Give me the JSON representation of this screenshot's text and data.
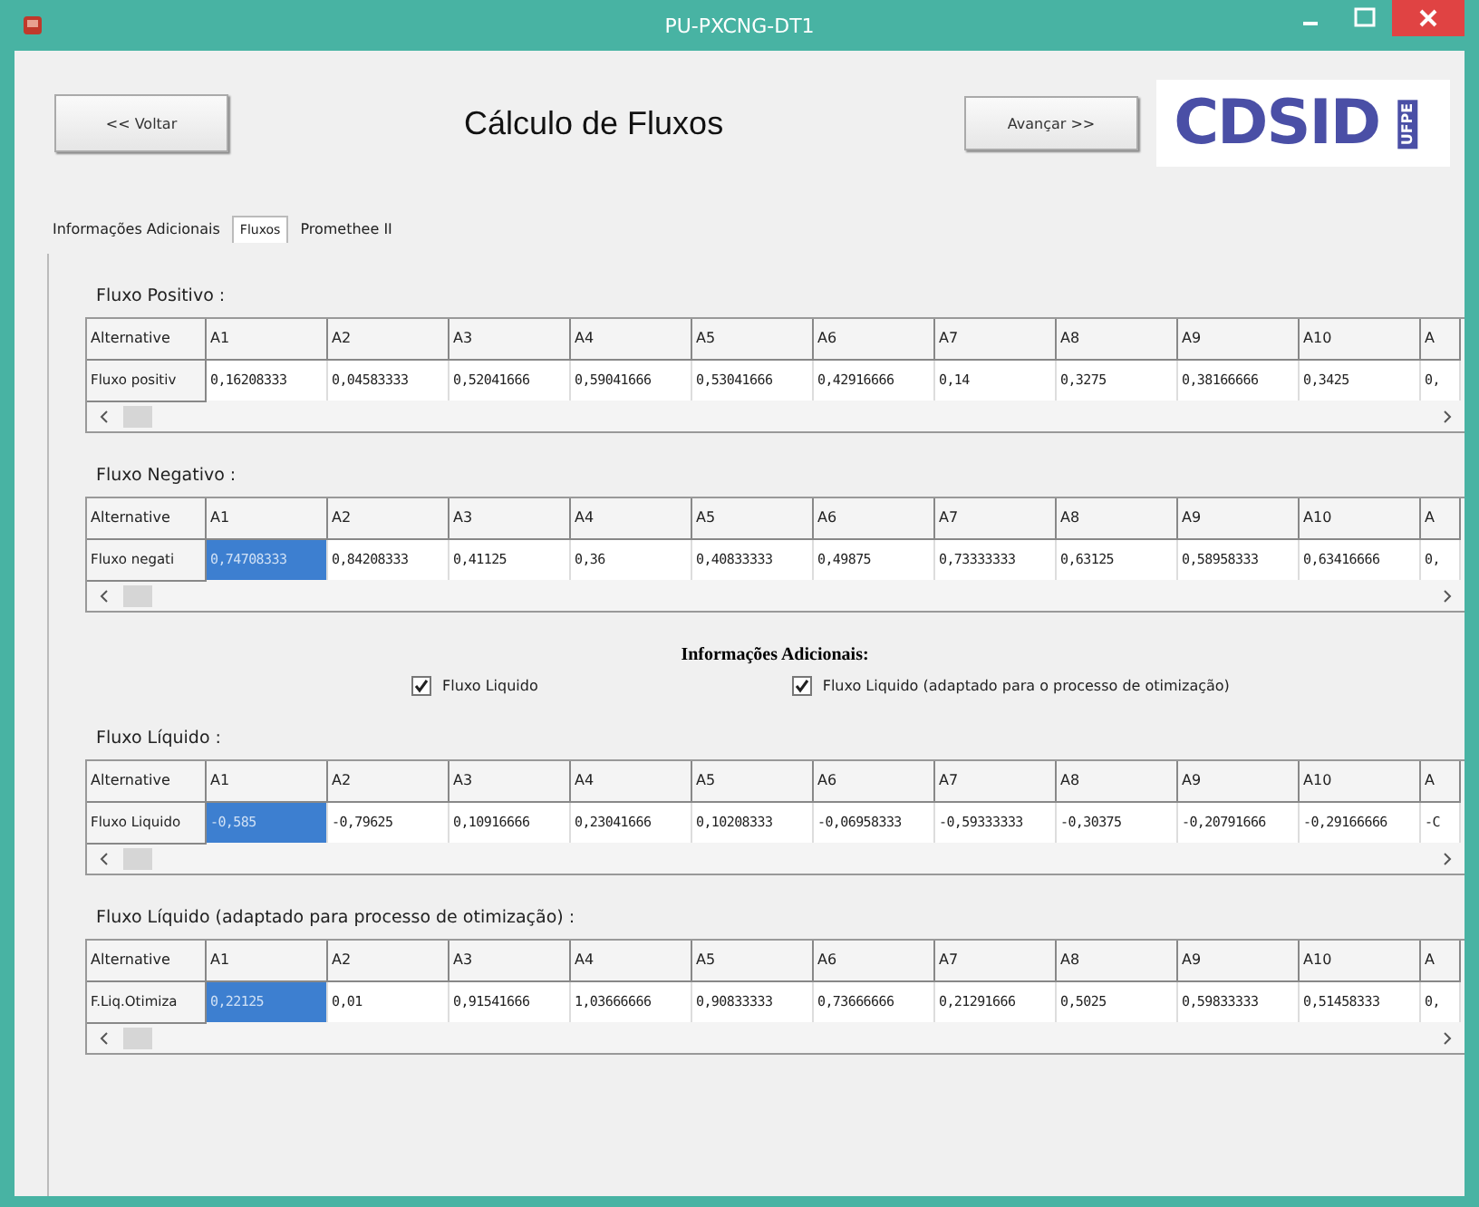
{
  "window": {
    "title": "PU-PXCNG-DT1"
  },
  "header": {
    "back_button": "<< Voltar",
    "title": "Cálculo de Fluxos",
    "next_button": "Avançar >>",
    "logo": {
      "main": "CDSID",
      "side": "UFPE"
    }
  },
  "tabs": [
    {
      "label": "Informações Adicionais",
      "selected": false
    },
    {
      "label": "Fluxos",
      "selected": true
    },
    {
      "label": "Promethee II",
      "selected": false
    }
  ],
  "sections": [
    {
      "heading": "Fluxo Positivo :",
      "columns": [
        "Alternative",
        "A1",
        "A2",
        "A3",
        "A4",
        "A5",
        "A6",
        "A7",
        "A8",
        "A9",
        "A10",
        "A"
      ],
      "row_label": "Fluxo positiv",
      "cells": [
        {
          "text": "0,16208333",
          "selected": false
        },
        {
          "text": "0,04583333",
          "selected": false
        },
        {
          "text": "0,52041666",
          "selected": false
        },
        {
          "text": "0,59041666",
          "selected": false
        },
        {
          "text": "0,53041666",
          "selected": false
        },
        {
          "text": "0,42916666",
          "selected": false
        },
        {
          "text": "0,14",
          "selected": false
        },
        {
          "text": "0,3275",
          "selected": false
        },
        {
          "text": "0,38166666",
          "selected": false
        },
        {
          "text": "0,3425",
          "selected": false
        },
        {
          "text": "0,",
          "selected": false
        }
      ]
    },
    {
      "heading": "Fluxo Negativo :",
      "columns": [
        "Alternative",
        "A1",
        "A2",
        "A3",
        "A4",
        "A5",
        "A6",
        "A7",
        "A8",
        "A9",
        "A10",
        "A"
      ],
      "row_label": "Fluxo negati",
      "cells": [
        {
          "text": "0,74708333",
          "selected": true
        },
        {
          "text": "0,84208333",
          "selected": false
        },
        {
          "text": "0,41125",
          "selected": false
        },
        {
          "text": "0,36",
          "selected": false
        },
        {
          "text": "0,40833333",
          "selected": false
        },
        {
          "text": "0,49875",
          "selected": false
        },
        {
          "text": "0,73333333",
          "selected": false
        },
        {
          "text": "0,63125",
          "selected": false
        },
        {
          "text": "0,58958333",
          "selected": false
        },
        {
          "text": "0,63416666",
          "selected": false
        },
        {
          "text": "0,",
          "selected": false
        }
      ]
    }
  ],
  "options": {
    "heading": "Informações Adicionais:",
    "checkboxes": [
      {
        "label": "Fluxo Liquido",
        "checked": true
      },
      {
        "label": "Fluxo Liquido (adaptado para o processo de otimização)",
        "checked": true
      }
    ]
  },
  "sections_after": [
    {
      "heading": "Fluxo Líquido :",
      "columns": [
        "Alternative",
        "A1",
        "A2",
        "A3",
        "A4",
        "A5",
        "A6",
        "A7",
        "A8",
        "A9",
        "A10",
        "A"
      ],
      "row_label": "Fluxo Liquido",
      "cells": [
        {
          "text": "-0,585",
          "selected": true
        },
        {
          "text": "-0,79625",
          "selected": false
        },
        {
          "text": "0,10916666",
          "selected": false
        },
        {
          "text": "0,23041666",
          "selected": false
        },
        {
          "text": "0,10208333",
          "selected": false
        },
        {
          "text": "-0,06958333",
          "selected": false
        },
        {
          "text": "-0,59333333",
          "selected": false
        },
        {
          "text": "-0,30375",
          "selected": false
        },
        {
          "text": "-0,20791666",
          "selected": false
        },
        {
          "text": "-0,29166666",
          "selected": false
        },
        {
          "text": "-C",
          "selected": false
        }
      ]
    },
    {
      "heading": "Fluxo Líquido (adaptado para processo de otimização) :",
      "columns": [
        "Alternative",
        "A1",
        "A2",
        "A3",
        "A4",
        "A5",
        "A6",
        "A7",
        "A8",
        "A9",
        "A10",
        "A"
      ],
      "row_label": "F.Liq.Otimiza",
      "cells": [
        {
          "text": "0,22125",
          "selected": true
        },
        {
          "text": "0,01",
          "selected": false
        },
        {
          "text": "0,91541666",
          "selected": false
        },
        {
          "text": "1,03666666",
          "selected": false
        },
        {
          "text": "0,90833333",
          "selected": false
        },
        {
          "text": "0,73666666",
          "selected": false
        },
        {
          "text": "0,21291666",
          "selected": false
        },
        {
          "text": "0,5025",
          "selected": false
        },
        {
          "text": "0,59833333",
          "selected": false
        },
        {
          "text": "0,51458333",
          "selected": false
        },
        {
          "text": "0,",
          "selected": false
        }
      ]
    }
  ]
}
